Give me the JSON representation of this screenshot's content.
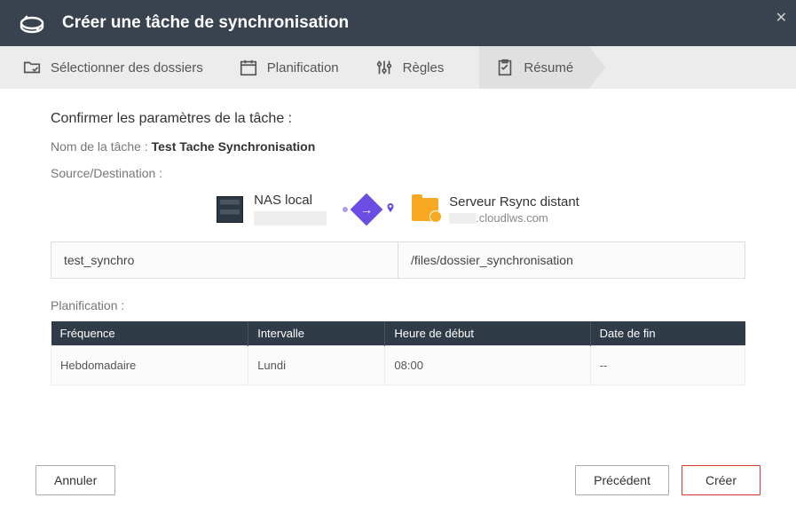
{
  "header": {
    "title": "Créer une tâche de synchronisation"
  },
  "steps": {
    "select": "Sélectionner des dossiers",
    "plan": "Planification",
    "rules": "Règles",
    "summary": "Résumé"
  },
  "summary": {
    "confirm_label": "Confirmer les paramètres de la tâche :",
    "task_name_label": "Nom de la tâche :",
    "task_name_value": "Test Tache Synchronisation",
    "source_dest_label": "Source/Destination :",
    "nas_local_label": "NAS local",
    "rsync_label": "Serveur Rsync distant",
    "rsync_host_suffix": ".cloudlws.com",
    "source_path": "test_synchro",
    "dest_path": "/files/dossier_synchronisation",
    "plan_label": "Planification :"
  },
  "schedule": {
    "headers": {
      "freq": "Fréquence",
      "interval": "Intervalle",
      "start": "Heure de début",
      "end": "Date de fin"
    },
    "row": {
      "freq": "Hebdomadaire",
      "interval": "Lundi",
      "start": "08:00",
      "end": "--"
    }
  },
  "footer": {
    "cancel": "Annuler",
    "prev": "Précédent",
    "create": "Créer"
  }
}
